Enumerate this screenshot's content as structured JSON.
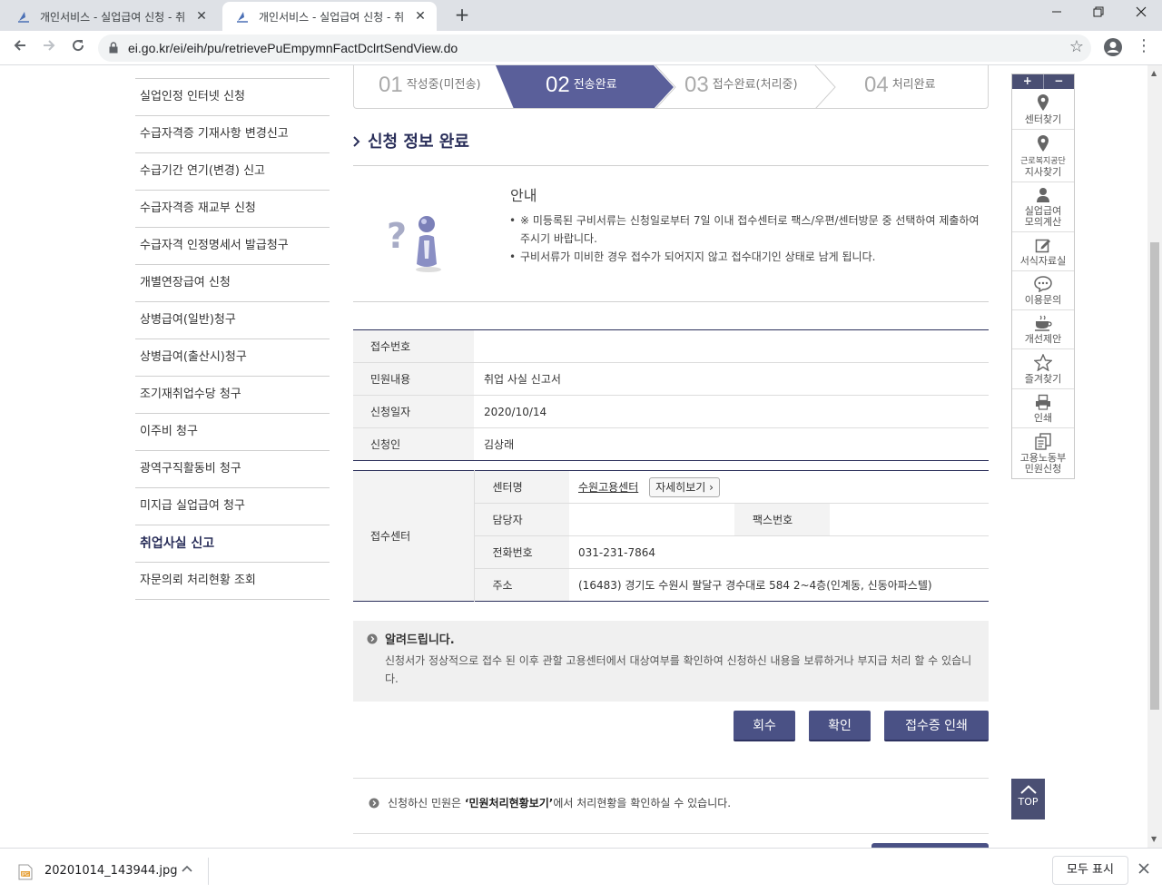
{
  "browser": {
    "tabs": [
      {
        "title": "개인서비스 - 실업급여 신청 - 취"
      },
      {
        "title": "개인서비스 - 실업급여 신청 - 취"
      }
    ],
    "new_tab": "+",
    "close": "✕",
    "url": "ei.go.kr/ei/eih/pu/retrievePuEmpymnFactDclrtSendView.do"
  },
  "left_menu": [
    {
      "label": "실업인정 인터넷 신청"
    },
    {
      "label": "수급자격증 기재사항 변경신고"
    },
    {
      "label": "수급기간 연기(변경) 신고"
    },
    {
      "label": "수급자격증 재교부 신청"
    },
    {
      "label": "수급자격 인정명세서 발급청구"
    },
    {
      "label": "개별연장급여 신청"
    },
    {
      "label": "상병급여(일반)청구"
    },
    {
      "label": "상병급여(출산시)청구"
    },
    {
      "label": "조기재취업수당 청구"
    },
    {
      "label": "이주비 청구"
    },
    {
      "label": "광역구직활동비 청구"
    },
    {
      "label": "미지급 실업급여 청구"
    },
    {
      "label": "취업사실 신고",
      "active": true
    },
    {
      "label": "자문의뢰 처리현황 조회"
    }
  ],
  "steps": [
    {
      "num": "01",
      "label": "작성중(미전송)"
    },
    {
      "num": "02",
      "label": "전송완료",
      "active": true
    },
    {
      "num": "03",
      "label": "접수완료(처리중)"
    },
    {
      "num": "04",
      "label": "처리완료"
    }
  ],
  "section_title": "신청 정보 완료",
  "notice": {
    "title": "안내",
    "items": [
      "※ 미등록된 구비서류는 신청일로부터 7일 이내 접수센터로 팩스/우편/센터방문 중 선택하여 제출하여 주시기 바랍니다.",
      "구비서류가 미비한 경우 접수가 되어지지 않고 접수대기인 상태로 남게 됩니다."
    ]
  },
  "application": {
    "receipt_no_label": "접수번호",
    "receipt_no": "",
    "content_label": "민원내용",
    "content": "취업 사실 신고서",
    "date_label": "신청일자",
    "date": "2020/10/14",
    "applicant_label": "신청인",
    "applicant": "김상래"
  },
  "center": {
    "group_label": "접수센터",
    "name_label": "센터명",
    "name": "수원고용센터",
    "detail_button": "자세히보기 ›",
    "manager_label": "담당자",
    "manager": "",
    "fax_label": "팩스번호",
    "fax": "",
    "phone_label": "전화번호",
    "phone": "031-231-7864",
    "address_label": "주소",
    "address": "(16483) 경기도 수원시 팔달구 경수대로 584 2~4층(인계동, 신동아파스텔)"
  },
  "info": {
    "title": "알려드립니다.",
    "body": "신청서가 정상적으로 접수 된 이후 관할 고용센터에서 대상여부를 확인하여 신청하신 내용을 보류하거나 부지급 처리 할 수 있습니다."
  },
  "buttons": {
    "retract": "회수",
    "confirm": "확인",
    "print_receipt": "접수증 인쇄"
  },
  "bottom_notice": {
    "before": "신청하신 민원은 ",
    "bold": "‘민원처리현황보기’",
    "after": "에서 처리현황을 확인하실 수 있습니다."
  },
  "quick_menu": {
    "zoom_in": "+",
    "zoom_out": "−",
    "items": [
      {
        "label": "센터찾기",
        "icon": "location-pin-icon"
      },
      {
        "label_small": "근로복지공단",
        "label": "지사찾기",
        "icon": "location-pin-icon"
      },
      {
        "label": "실업급여\n모의계산",
        "icon": "person-icon"
      },
      {
        "label": "서식자료실",
        "icon": "edit-document-icon"
      },
      {
        "label": "이용문의",
        "icon": "speech-bubble-icon"
      },
      {
        "label": "개선제안",
        "icon": "coffee-cup-icon"
      },
      {
        "label": "즐겨찾기",
        "icon": "star-icon"
      },
      {
        "label": "인쇄",
        "icon": "printer-icon"
      },
      {
        "label": "고용노동부\n민원신청",
        "icon": "documents-icon"
      }
    ],
    "top": "TOP"
  },
  "downloads": {
    "file": "20201014_143944.jpg",
    "show_all": "모두 표시"
  }
}
